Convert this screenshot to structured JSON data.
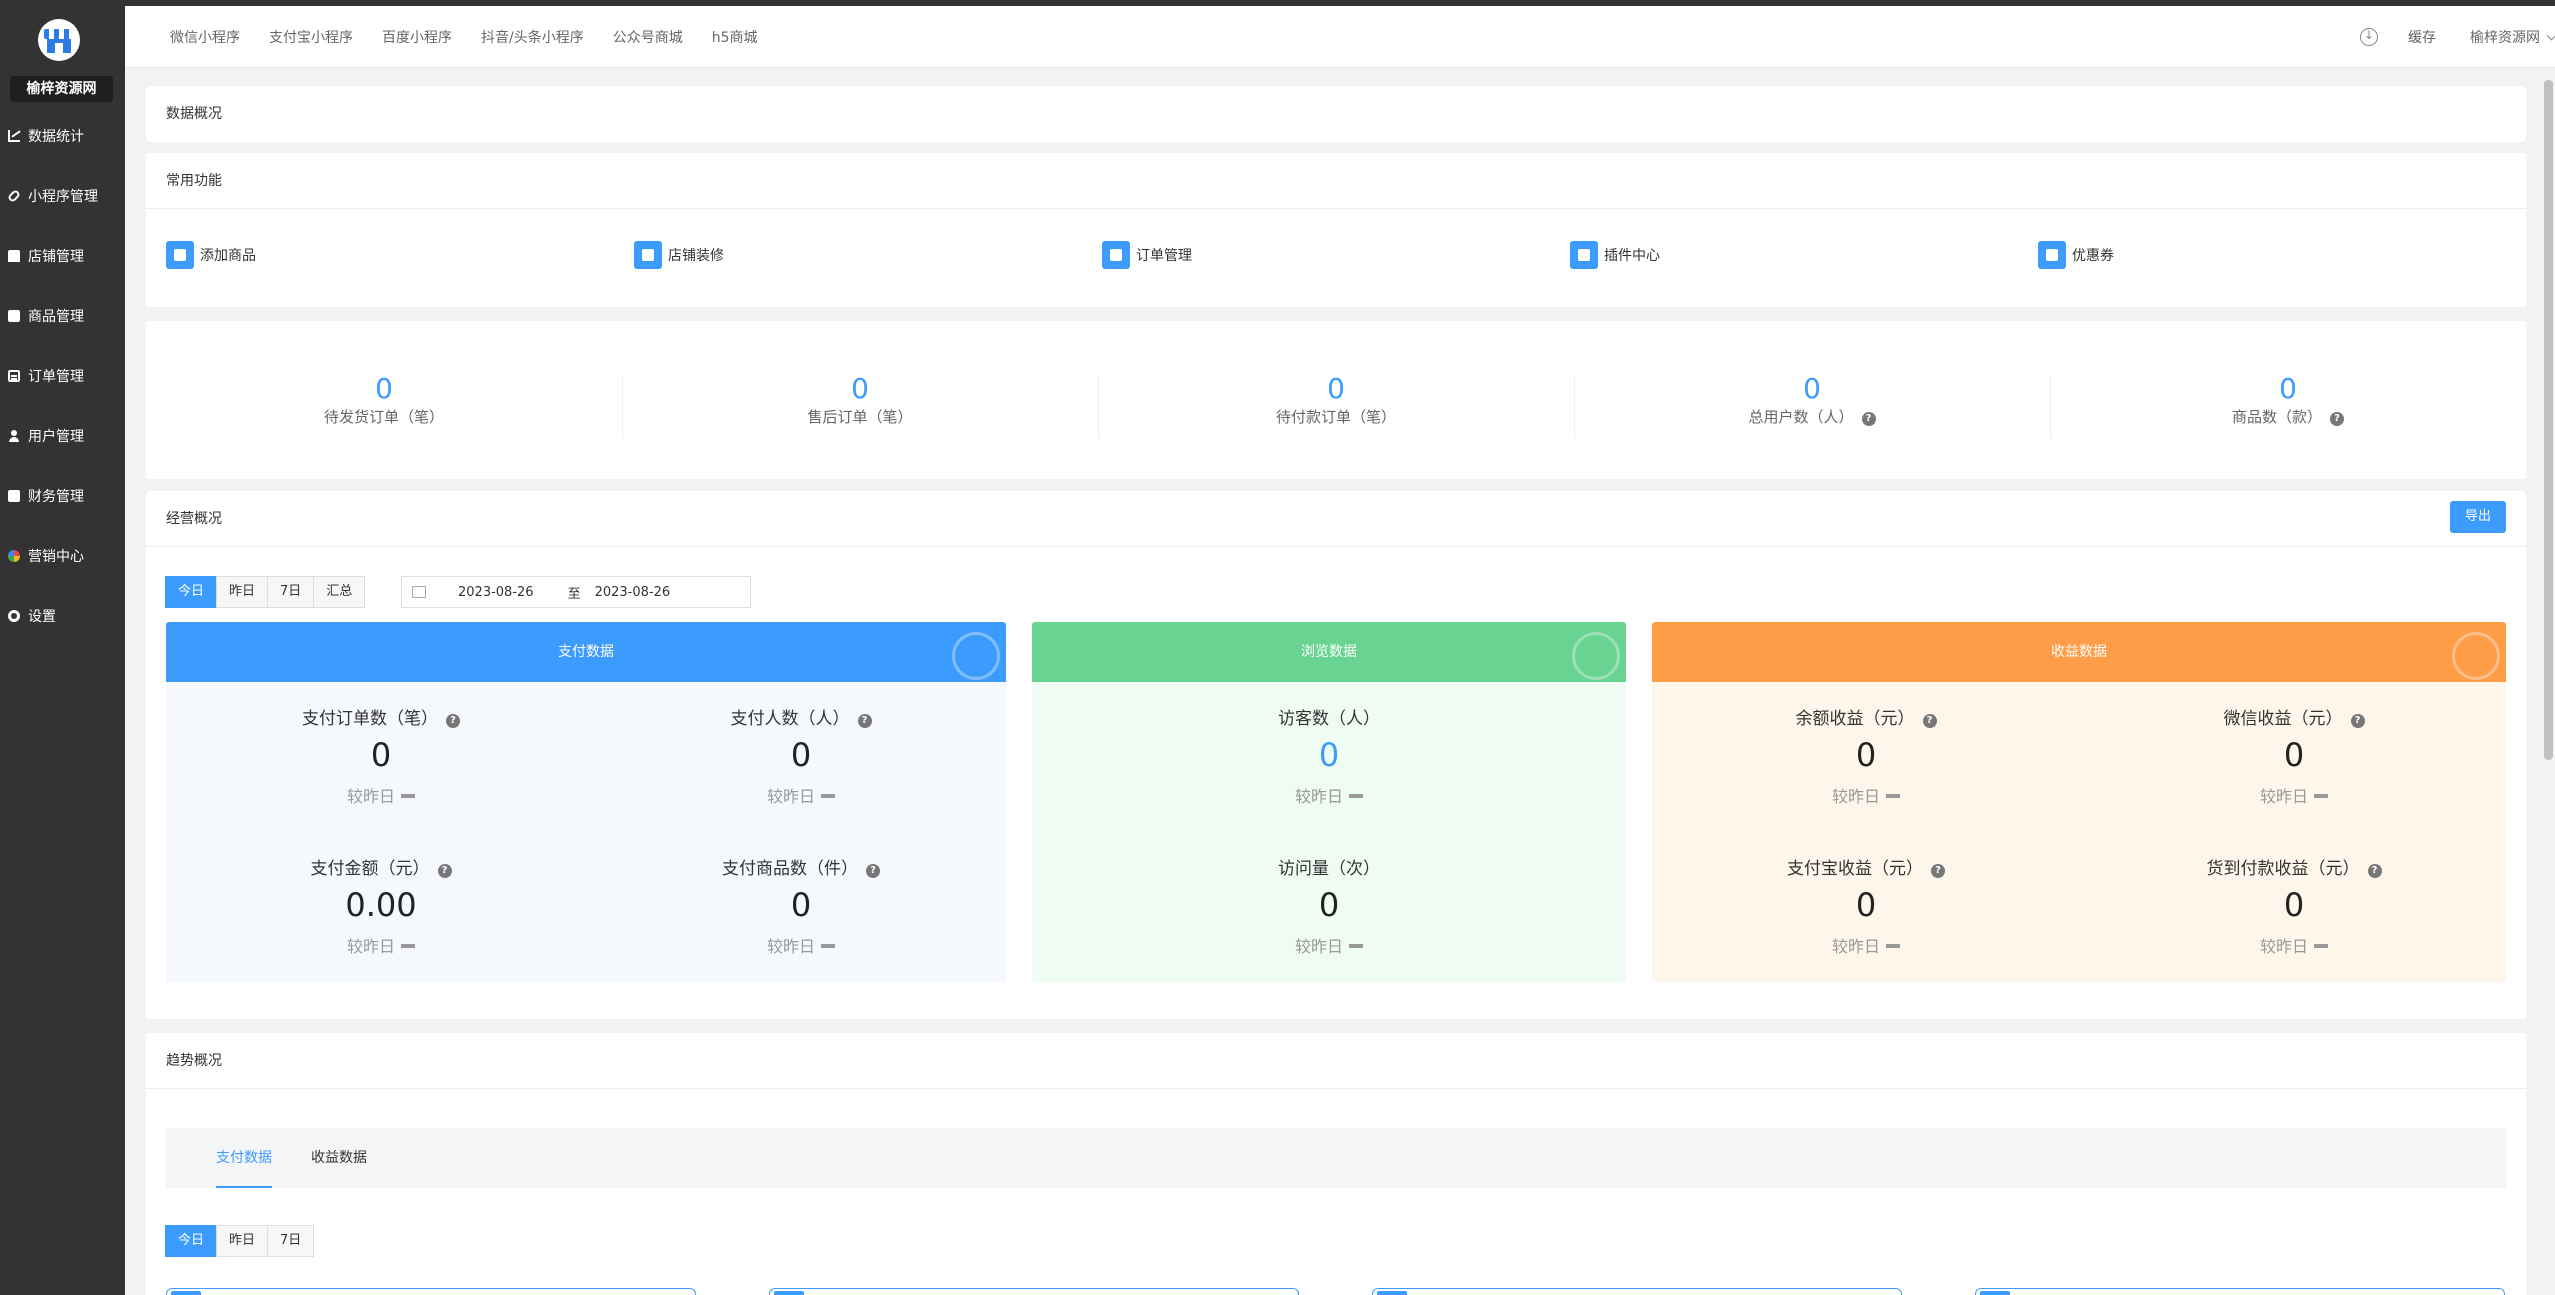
{
  "sidebar": {
    "brand": "榆梓资源网",
    "items": [
      {
        "label": "数据统计",
        "icon": "line-chart-icon"
      },
      {
        "label": "小程序管理",
        "icon": "link-icon"
      },
      {
        "label": "店铺管理",
        "icon": "store-icon"
      },
      {
        "label": "商品管理",
        "icon": "goods-icon"
      },
      {
        "label": "订单管理",
        "icon": "order-icon"
      },
      {
        "label": "用户管理",
        "icon": "user-icon"
      },
      {
        "label": "财务管理",
        "icon": "finance-icon"
      },
      {
        "label": "营销中心",
        "icon": "marketing-icon"
      },
      {
        "label": "设置",
        "icon": "settings-icon"
      }
    ]
  },
  "header": {
    "tabs": [
      "微信小程序",
      "支付宝小程序",
      "百度小程序",
      "抖音/头条小程序",
      "公众号商城",
      "h5商城"
    ],
    "cache": "缓存",
    "user": "榆梓资源网"
  },
  "overview_title": "数据概况",
  "common": {
    "title": "常用功能",
    "items": [
      {
        "label": "添加商品",
        "icon": "add-goods-icon"
      },
      {
        "label": "店铺装修",
        "icon": "home-icon"
      },
      {
        "label": "订单管理",
        "icon": "clipboard-icon"
      },
      {
        "label": "插件中心",
        "icon": "puzzle-icon"
      },
      {
        "label": "优惠券",
        "icon": "coupon-icon"
      }
    ]
  },
  "stats": [
    {
      "value": "0",
      "label": "待发货订单（笔）",
      "help": false
    },
    {
      "value": "0",
      "label": "售后订单（笔）",
      "help": false
    },
    {
      "value": "0",
      "label": "待付款订单（笔）",
      "help": false
    },
    {
      "value": "0",
      "label": "总用户数（人）",
      "help": true
    },
    {
      "value": "0",
      "label": "商品数（款）",
      "help": true
    }
  ],
  "business": {
    "title": "经营概况",
    "export": "导出",
    "ranges": [
      "今日",
      "昨日",
      "7日",
      "汇总"
    ],
    "date_from": "2023-08-26",
    "date_sep": "至",
    "date_to": "2023-08-26",
    "compare": "较昨日",
    "pay": {
      "title": "支付数据",
      "metrics": [
        {
          "label": "支付订单数（笔）",
          "value": "0"
        },
        {
          "label": "支付人数（人）",
          "value": "0"
        },
        {
          "label": "支付金额（元）",
          "value": "0.00"
        },
        {
          "label": "支付商品数（件）",
          "value": "0"
        }
      ]
    },
    "browse": {
      "title": "浏览数据",
      "metrics": [
        {
          "label": "访客数（人）",
          "value": "0"
        },
        {
          "label": "访问量（次）",
          "value": "0"
        }
      ]
    },
    "income": {
      "title": "收益数据",
      "metrics": [
        {
          "label": "余额收益（元）",
          "value": "0"
        },
        {
          "label": "微信收益（元）",
          "value": "0"
        },
        {
          "label": "支付宝收益（元）",
          "value": "0"
        },
        {
          "label": "货到付款收益（元）",
          "value": "0"
        }
      ]
    }
  },
  "trend": {
    "title": "趋势概况",
    "tabs": [
      "支付数据",
      "收益数据"
    ],
    "ranges": [
      "今日",
      "昨日",
      "7日"
    ]
  },
  "colors": {
    "accent": "#3c9cfe",
    "pay_header": "#3c9cfe",
    "browse_header": "#69d391",
    "income_header": "#fe9c47"
  }
}
